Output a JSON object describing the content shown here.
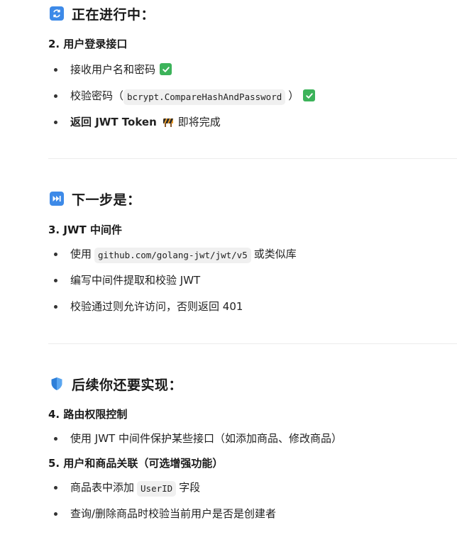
{
  "section1": {
    "icon": "refresh-icon",
    "title": "正在进行中：",
    "subheading": "2. 用户登录接口",
    "item1_text": "接收用户名和密码",
    "item2_text": "校验密码（",
    "item2_code": "bcrypt.CompareHashAndPassword",
    "item2_close": "）",
    "item3_bold": "返回 JWT Token",
    "item3_rest": "即将完成"
  },
  "section2": {
    "icon": "next-track-icon",
    "title": "下一步是：",
    "subheading": "3. JWT 中间件",
    "item1_pre": "使用",
    "item1_code": "github.com/golang-jwt/jwt/v5",
    "item1_post": "或类似库",
    "item2_text": "编写中间件提取和校验 JWT",
    "item3_text": "校验通过则允许访问，否则返回 401"
  },
  "section3": {
    "icon": "shield-icon",
    "title": "后续你还要实现：",
    "subheading1": "4. 路由权限控制",
    "sub1_item1": "使用 JWT 中间件保护某些接口（如添加商品、修改商品）",
    "subheading2": "5. 用户和商品关联（可选增强功能）",
    "sub2_item1_pre": "商品表中添加",
    "sub2_item1_code": "UserID",
    "sub2_item1_post": "字段",
    "sub2_item2": "查询/删除商品时校验当前用户是否是创建者"
  },
  "colors": {
    "accent_blue": "#3d8ae8",
    "check_green": "#3cb35a",
    "code_bg": "#f0f0f0"
  }
}
